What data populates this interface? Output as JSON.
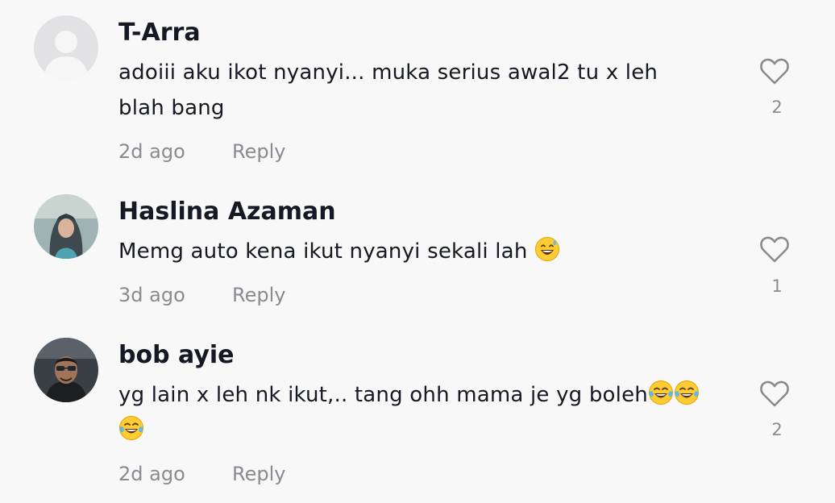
{
  "comments": [
    {
      "username": "T-Arra",
      "text_line1": "adoiii aku ikot nyanyi... muka serius awal2 tu x leh",
      "text_line2": "blah bang",
      "time": "2d ago",
      "reply_label": "Reply",
      "like_count": "2",
      "avatar": "default-avatar-icon"
    },
    {
      "username": "Haslina Azaman",
      "text": "Memg auto kena ikut nyanyi sekali lah",
      "emoji": "sweat-smile-emoji",
      "time": "3d ago",
      "reply_label": "Reply",
      "like_count": "1",
      "avatar": "user-photo"
    },
    {
      "username": "bob ayie",
      "text_line1": "yg lain x leh nk ikut,.. tang ohh mama je yg boleh",
      "emoji": "tears-of-joy-emoji",
      "time": "2d ago",
      "reply_label": "Reply",
      "like_count": "2",
      "avatar": "user-photo"
    }
  ],
  "colors": {
    "background": "#f8f8f8",
    "primary_text": "#161823",
    "secondary_text": "#8a8b91"
  }
}
